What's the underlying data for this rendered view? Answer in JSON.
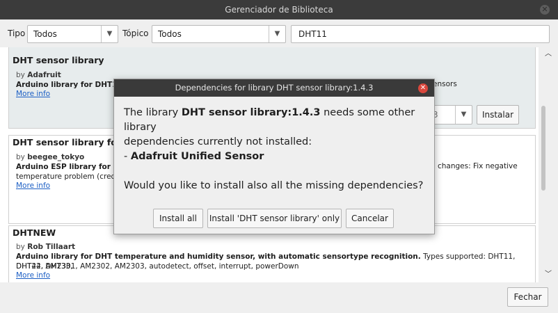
{
  "window": {
    "title": "Gerenciador de Biblioteca"
  },
  "filters": {
    "tipo_label": "Tipo",
    "tipo_value": "Todos",
    "topico_label": "Tópico",
    "topico_value": "Todos",
    "search_value": "DHT11"
  },
  "libraries": [
    {
      "name": "DHT sensor library",
      "by_prefix": "by",
      "author": "Adafruit",
      "desc_bold": "Arduino library for DHT11, D",
      "desc_tail": "ensors",
      "more_info": "More info",
      "version_partial": "3",
      "install_label": "Instalar"
    },
    {
      "name": "DHT sensor library for ES",
      "by_prefix": "by",
      "author": "beegee_tokyo",
      "desc_bold": "Arduino ESP library for DHT",
      "desc_line2": "temperature problem (credits",
      "desc_tail": "changes: Fix negative",
      "more_info": "More info"
    },
    {
      "name": "DHTNEW",
      "by_prefix": "by",
      "author": "Rob Tillaart",
      "desc_bold": "Arduino library for DHT temperature and humidity sensor, with automatic sensortype recognition.",
      "desc_rest": " Types supported: DHT11, DHT22, DHT33,",
      "desc_line2": "DHT44, AM2301, AM2302, AM2303, autodetect, offset, interrupt, powerDown",
      "more_info": "More info"
    }
  ],
  "footer": {
    "close_label": "Fechar"
  },
  "dialog": {
    "title": "Dependencies for library DHT sensor library:1.4.3",
    "msg_pre": "The library ",
    "msg_lib": "DHT sensor library:1.4.3",
    "msg_post": " needs some other library",
    "msg_line2": "dependencies currently not installed:",
    "dep_prefix": "- ",
    "dep_name": "Adafruit Unified Sensor",
    "question": "Would you like to install also all the missing dependencies?",
    "install_all_label": "Install all",
    "install_only_label": "Install 'DHT sensor library' only",
    "cancel_label": "Cancelar"
  },
  "colors": {
    "titlebar": "#3b3b3b",
    "link": "#1b5ec4",
    "dialog_close": "#d9473c",
    "selected_item": "#e7eced"
  },
  "icons": {
    "window_close": "close-icon",
    "dialog_close": "close-circle-icon",
    "dropdown": "chevron-down-icon",
    "scroll_up": "chevron-up-icon",
    "scroll_down": "chevron-down-icon"
  }
}
